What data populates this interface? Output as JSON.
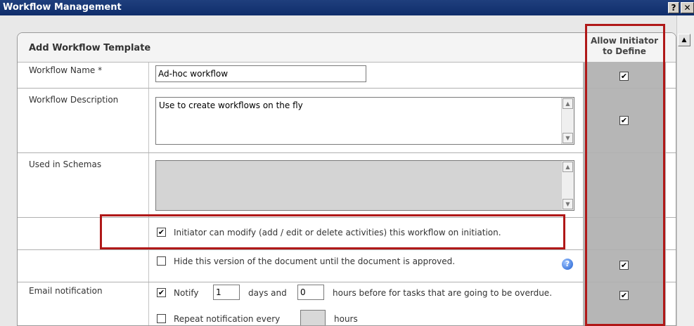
{
  "window": {
    "title": "Workflow Management",
    "help_label": "?",
    "close_label": "✕"
  },
  "panel": {
    "title": "Add Workflow Template"
  },
  "column_header": "Allow Initiator to Define",
  "rows": {
    "name": {
      "label": "Workflow Name *",
      "value": "Ad-hoc workflow"
    },
    "description": {
      "label": "Workflow Description",
      "value": "Use to create workflows on the fly"
    },
    "schemas": {
      "label": "Used in Schemas",
      "value": ""
    },
    "initiator_modify": {
      "label": "Initiator can modify (add / edit or delete activities) this workflow on initiation.",
      "checked": true
    },
    "hide_version": {
      "label": "Hide this version of the document until the document is approved.",
      "checked": false
    },
    "email": {
      "label": "Email notification",
      "notify_label": "Notify",
      "notify_checked": true,
      "days_value": "1",
      "days_label": "days and",
      "hours_value": "0",
      "hours_label": "hours before for tasks that are going to be overdue.",
      "repeat_label": "Repeat notification every",
      "repeat_checked": false,
      "repeat_value": "",
      "repeat_unit": "hours"
    }
  },
  "allow_checks": {
    "name": true,
    "description": true,
    "hide_version": true,
    "email": true
  },
  "check_glyph": "✔",
  "icons": {
    "info": "info-icon",
    "scroll_up": "scroll-up-icon",
    "scroll_down": "scroll-down-icon"
  },
  "colors": {
    "title_bar": "#0f2d6b",
    "highlight": "#b01818",
    "column_bg": "#b6b6b6"
  }
}
